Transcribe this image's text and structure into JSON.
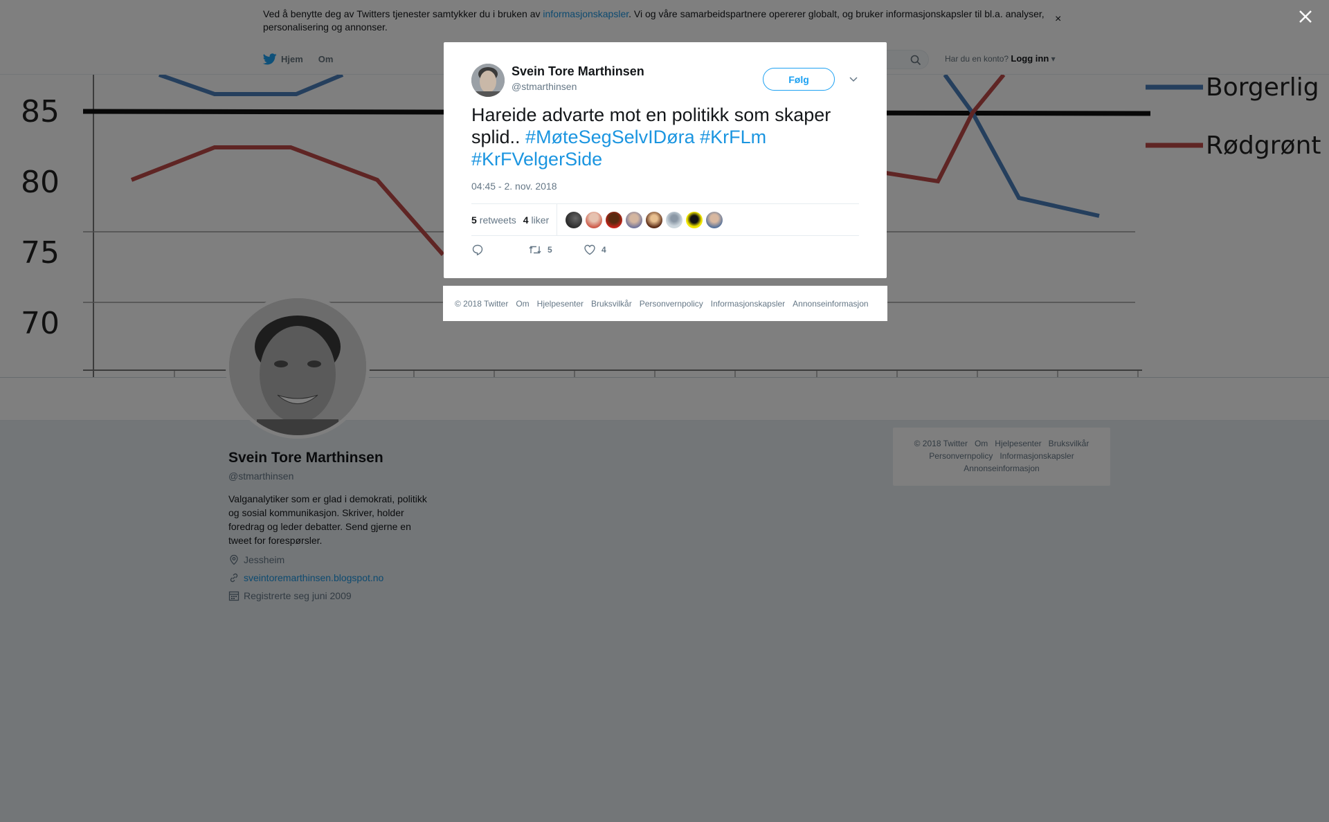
{
  "cookie": {
    "text_before": "Ved å benytte deg av Twitters tjenester samtykker du i bruken av ",
    "link": "informasjonskapsler",
    "text_after": ". Vi og våre samarbeidspartnere opererer globalt, og bruker informasjonskapsler til bl.a. analyser, personalisering og annonser.",
    "close": "×"
  },
  "nav": {
    "home": "Hjem",
    "about": "Om",
    "account_prompt": "Har du en konto?",
    "login": "Logg inn"
  },
  "banner_chart": {
    "y_ticks": [
      "85",
      "80",
      "75",
      "70"
    ],
    "legend": [
      {
        "label": "Borgerlig",
        "color": "#4a7ebb"
      },
      {
        "label": "Rødgrønt",
        "color": "#be4b48"
      }
    ]
  },
  "profile": {
    "name": "Svein Tore Marthinsen",
    "handle": "@stmarthinsen",
    "bio": "Valganalytiker som er glad i demokrati, politikk og sosial kommunikasjon. Skriver, holder foredrag og leder debatter. Send gjerne en tweet for forespørsler.",
    "location": "Jessheim",
    "website": "sveintoremarthinsen.blogspot.no",
    "joined": "Registrerte seg juni 2009"
  },
  "side_footer": {
    "items": [
      "© 2018 Twitter",
      "Om",
      "Hjelpesenter",
      "Bruksvilkår",
      "Personvernpolicy",
      "Informasjonskapsler",
      "Annonseinformasjon"
    ]
  },
  "tweet": {
    "name": "Svein Tore Marthinsen",
    "handle": "@stmarthinsen",
    "follow": "Følg",
    "text": "Hareide advarte mot en politikk som skaper splid.. ",
    "hashtags": [
      "#MøteSegSelvIDøra",
      "#KrFLm",
      "#KrFVelgerSide"
    ],
    "time": "04:45 - 2. nov. 2018",
    "retweets_count": "5",
    "retweets_label": "retweets",
    "likes_count": "4",
    "likes_label": "liker",
    "action_retweets": "5",
    "action_likes": "4"
  },
  "modal_footer": {
    "items": [
      "© 2018 Twitter",
      "Om",
      "Hjelpesenter",
      "Bruksvilkår",
      "Personvernpolicy",
      "Informasjonskapsler",
      "Annonseinformasjon"
    ]
  },
  "colors": {
    "link": "#1b95e0",
    "accent": "#1da1f2",
    "overlay": "rgba(0,0,0,0.5)"
  }
}
